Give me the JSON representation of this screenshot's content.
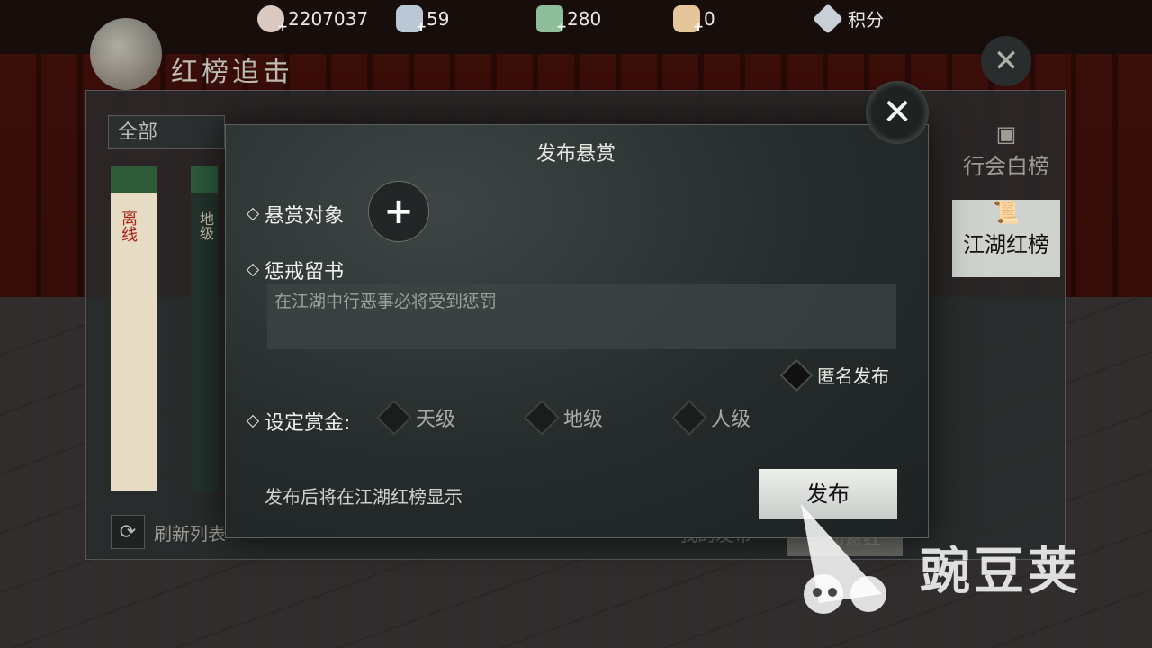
{
  "currency": {
    "silver": "2207037",
    "ingot": "59",
    "jade": "280",
    "gold": "0",
    "points_label": "积分"
  },
  "panel": {
    "title": "红榜追击",
    "filter": "全部",
    "card1_text": "离线",
    "card2_text": "地级",
    "refresh_label": "刷新列表",
    "my_publish_label": "我的发布",
    "second_button": "发布悬红"
  },
  "side_tabs": [
    {
      "label": "行会白榜",
      "icon": "notice-board-icon"
    },
    {
      "label": "江湖红榜",
      "icon": "scroll-icon"
    }
  ],
  "dialog": {
    "title": "发布悬赏",
    "target_label": "悬赏对象",
    "message_label": "惩戒留书",
    "message_placeholder": "在江湖中行恶事必将受到惩罚",
    "anonymous_label": "匿名发布",
    "reward_label": "设定赏金:",
    "tiers": [
      "天级",
      "地级",
      "人级"
    ],
    "note": "发布后将在江湖红榜显示",
    "publish_button": "发布"
  },
  "watermark": {
    "text": "豌豆荚"
  },
  "colors": {
    "dialog_bg": "#262c2c",
    "active_tab": "#cfd1cc",
    "publish_btn": "#e6e8e4"
  }
}
